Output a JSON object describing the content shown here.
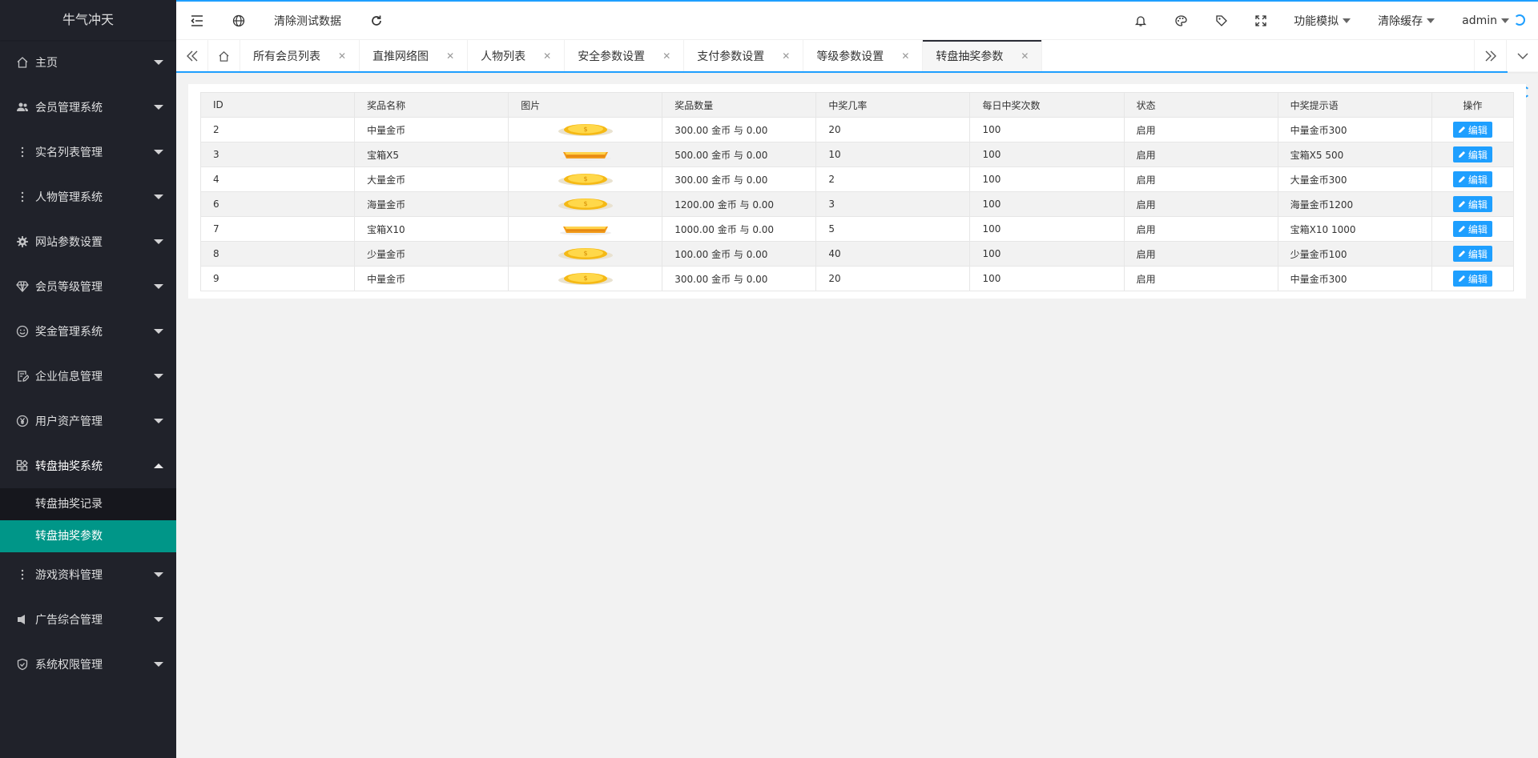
{
  "app": {
    "title": "牛气冲天"
  },
  "sidebar": {
    "items": [
      {
        "label": "主页",
        "icon": "home-icon"
      },
      {
        "label": "会员管理系统",
        "icon": "users-icon"
      },
      {
        "label": "实名列表管理",
        "icon": "more-vertical-icon"
      },
      {
        "label": "人物管理系统",
        "icon": "more-vertical-icon"
      },
      {
        "label": "网站参数设置",
        "icon": "gear-icon"
      },
      {
        "label": "会员等级管理",
        "icon": "diamond-icon"
      },
      {
        "label": "奖金管理系统",
        "icon": "smile-icon"
      },
      {
        "label": "企业信息管理",
        "icon": "edit-doc-icon"
      },
      {
        "label": "用户资产管理",
        "icon": "yen-icon"
      },
      {
        "label": "转盘抽奖系统",
        "icon": "apps-icon",
        "open": true
      },
      {
        "label": "游戏资料管理",
        "icon": "more-vertical-icon"
      },
      {
        "label": "广告综合管理",
        "icon": "speaker-icon"
      },
      {
        "label": "系统权限管理",
        "icon": "shield-icon"
      }
    ],
    "subitems": [
      {
        "label": "转盘抽奖记录"
      },
      {
        "label": "转盘抽奖参数",
        "active": true
      }
    ]
  },
  "header": {
    "clear_test": "清除测试数据",
    "feature_sim": "功能模拟",
    "clear_cache": "清除缓存",
    "user": "admin"
  },
  "tabs": [
    {
      "label": "所有会员列表"
    },
    {
      "label": "直推网络图"
    },
    {
      "label": "人物列表"
    },
    {
      "label": "安全参数设置"
    },
    {
      "label": "支付参数设置"
    },
    {
      "label": "等级参数设置"
    },
    {
      "label": "转盘抽奖参数",
      "active": true
    }
  ],
  "table": {
    "headers": [
      "ID",
      "奖品名称",
      "图片",
      "奖品数量",
      "中奖几率",
      "每日中奖次数",
      "状态",
      "中奖提示语",
      "操作"
    ],
    "rows": [
      {
        "id": "2",
        "name": "中量金币",
        "img": "coin",
        "qty": "300.00 金币 与 0.00",
        "rate": "20",
        "daily": "100",
        "status": "启用",
        "tip": "中量金币300"
      },
      {
        "id": "3",
        "name": "宝箱X5",
        "img": "bar",
        "qty": "500.00 金币 与 0.00",
        "rate": "10",
        "daily": "100",
        "status": "启用",
        "tip": "宝箱X5 500"
      },
      {
        "id": "4",
        "name": "大量金币",
        "img": "coin",
        "qty": "300.00 金币 与 0.00",
        "rate": "2",
        "daily": "100",
        "status": "启用",
        "tip": "大量金币300"
      },
      {
        "id": "6",
        "name": "海量金币",
        "img": "coin",
        "qty": "1200.00 金币 与 0.00",
        "rate": "3",
        "daily": "100",
        "status": "启用",
        "tip": "海量金币1200"
      },
      {
        "id": "7",
        "name": "宝箱X10",
        "img": "bar",
        "qty": "1000.00 金币 与 0.00",
        "rate": "5",
        "daily": "100",
        "status": "启用",
        "tip": "宝箱X10 1000"
      },
      {
        "id": "8",
        "name": "少量金币",
        "img": "coin",
        "qty": "100.00 金币 与 0.00",
        "rate": "40",
        "daily": "100",
        "status": "启用",
        "tip": "少量金币100"
      },
      {
        "id": "9",
        "name": "中量金币",
        "img": "coin",
        "qty": "300.00 金币 与 0.00",
        "rate": "20",
        "daily": "100",
        "status": "启用",
        "tip": "中量金币300"
      }
    ],
    "edit_label": "编辑"
  },
  "colors": {
    "sidebar_bg": "#20222a",
    "active_green": "#009688",
    "accent_blue": "#1e9fff"
  }
}
